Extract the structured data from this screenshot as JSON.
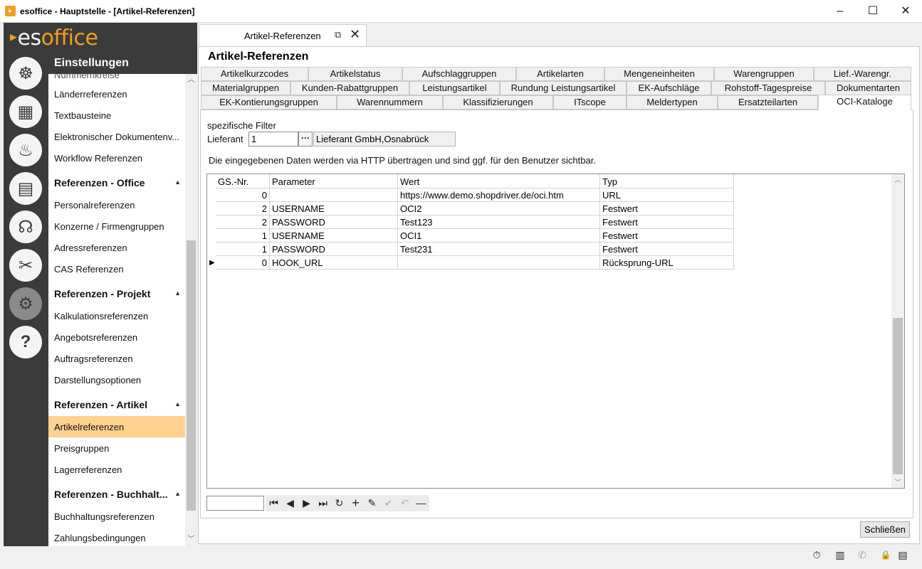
{
  "window": {
    "title": "esoffice - Hauptstelle - [Artikel-Referenzen]",
    "app_icon": "esoffice-icon",
    "minimize": "–",
    "maximize": "☐",
    "close": "✕"
  },
  "logo": {
    "prefix": "es",
    "suffix": "office",
    "accent": "#f29e1f"
  },
  "rail": {
    "icons": [
      {
        "name": "helm-icon",
        "glyph": "☸"
      },
      {
        "name": "calculator-icon",
        "glyph": "▦"
      },
      {
        "name": "alarm-light-icon",
        "glyph": "♨"
      },
      {
        "name": "cash-icon",
        "glyph": "▤"
      },
      {
        "name": "headset-icon",
        "glyph": "☊"
      },
      {
        "name": "tools-icon",
        "glyph": "✂"
      },
      {
        "name": "settings-gears-icon",
        "glyph": "⚙"
      },
      {
        "name": "help-icon",
        "glyph": "?"
      }
    ]
  },
  "sidebar": {
    "heading": "Einstellungen",
    "partial_top": "Nummernkreise",
    "items_top": [
      "Länderreferenzen",
      "Textbausteine",
      "Elektronischer Dokumentenv...",
      "Workflow Referenzen"
    ],
    "groups": [
      {
        "title": "Referenzen - Office",
        "items": [
          "Personalreferenzen",
          "Konzerne / Firmengruppen",
          "Adressreferenzen",
          "CAS Referenzen"
        ]
      },
      {
        "title": "Referenzen - Projekt",
        "items": [
          "Kalkulationsreferenzen",
          "Angebotsreferenzen",
          "Auftragsreferenzen",
          "Darstellungsoptionen"
        ]
      },
      {
        "title": "Referenzen - Artikel",
        "items": [
          "Artikelreferenzen",
          "Preisgruppen",
          "Lagerreferenzen"
        ]
      },
      {
        "title": "Referenzen - Buchhalt...",
        "items": [
          "Buchhaltungsreferenzen",
          "Zahlungsbedingungen"
        ]
      }
    ],
    "active_item": "Artikelreferenzen"
  },
  "doc_tab": {
    "label": "Artikel-Referenzen",
    "popout_icon": "⧉",
    "close_icon": "✕"
  },
  "page": {
    "title": "Artikel-Referenzen"
  },
  "tabs": {
    "row1": [
      "Artikelkurzcodes",
      "Artikelstatus",
      "Aufschlaggruppen",
      "Artikelarten",
      "Mengeneinheiten",
      "Warengruppen",
      "Lief.-Warengr."
    ],
    "row2": [
      "Materialgruppen",
      "Kunden-Rabattgruppen",
      "Leistungsartikel",
      "Rundung Leistungsartikel",
      "EK-Aufschläge",
      "Rohstoff-Tagespreise",
      "Dokumentarten"
    ],
    "row3": [
      "EK-Kontierungsgruppen",
      "Warennummern",
      "Klassifizierungen",
      "ITscope",
      "Meldertypen",
      "Ersatzteilarten",
      "OCI-Kataloge"
    ],
    "selected": "OCI-Kataloge"
  },
  "filter": {
    "heading": "spezifische Filter",
    "lieferant_label": "Lieferant",
    "lieferant_value": "1",
    "lieferant_button": "···",
    "lieferant_name": "Lieferant GmbH,Osnabrück"
  },
  "info_text": "Die eingegebenen Daten werden via HTTP übertragen und sind ggf. für den Benutzer sichtbar.",
  "grid": {
    "columns": [
      "GS.-Nr.",
      "Parameter",
      "Wert",
      "Typ"
    ],
    "rows": [
      [
        "0",
        "",
        "https://www.demo.shopdriver.de/oci.htm",
        "URL"
      ],
      [
        "2",
        "USERNAME",
        "OCI2",
        "Festwert"
      ],
      [
        "2",
        "PASSWORD",
        "Test123",
        "Festwert"
      ],
      [
        "1",
        "USERNAME",
        "OCI1",
        "Festwert"
      ],
      [
        "1",
        "PASSWORD",
        "Test231",
        "Festwert"
      ],
      [
        "0",
        "HOOK_URL",
        "",
        "Rücksprung-URL"
      ]
    ],
    "current_row_marker": "▶"
  },
  "navigator": {
    "first": "⏮",
    "prev": "◀",
    "next": "▶",
    "last": "⏭",
    "refresh": "↻",
    "add": "+",
    "edit": "✎",
    "post": "✔",
    "cancel": "↶",
    "delete": "—"
  },
  "buttons": {
    "close": "Schließen"
  },
  "status_icons": [
    {
      "name": "stopwatch-icon",
      "glyph": "⏱"
    },
    {
      "name": "building-icon",
      "glyph": "▥"
    },
    {
      "name": "phone-icon",
      "glyph": "✆"
    },
    {
      "name": "lock-icon",
      "glyph": "🔒"
    },
    {
      "name": "database-icon",
      "glyph": "▤"
    }
  ]
}
